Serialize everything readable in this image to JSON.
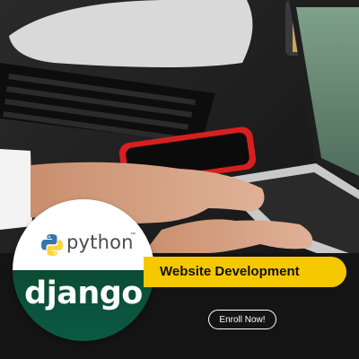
{
  "brand": {
    "python_word": "python",
    "python_tm": "™",
    "django_word": "django"
  },
  "banner": {
    "title": "Website Development"
  },
  "cta": {
    "label": "Enroll Now!"
  },
  "colors": {
    "banner_yellow": "#f6c800",
    "django_green": "#0c4b33",
    "python_blue": "#3776ab",
    "python_yellow": "#ffd43b"
  },
  "icons": [
    "python-logo-icon"
  ]
}
